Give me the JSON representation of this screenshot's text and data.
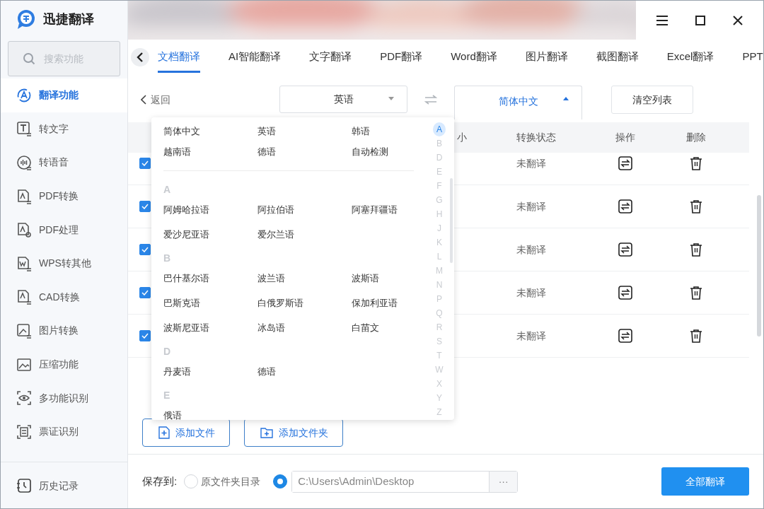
{
  "app": {
    "title": "迅捷翻译"
  },
  "sidebar": {
    "search": {
      "placeholder": "搜索功能"
    },
    "items": [
      {
        "label": "翻译功能",
        "selected": true
      },
      {
        "label": "转文字",
        "selected": false
      },
      {
        "label": "转语音",
        "selected": false
      },
      {
        "label": "PDF转换",
        "selected": false
      },
      {
        "label": "PDF处理",
        "selected": false
      },
      {
        "label": "WPS转其他",
        "selected": false
      },
      {
        "label": "CAD转换",
        "selected": false
      },
      {
        "label": "图片转换",
        "selected": false
      },
      {
        "label": "压缩功能",
        "selected": false
      },
      {
        "label": "多功能识别",
        "selected": false
      },
      {
        "label": "票证识别",
        "selected": false
      }
    ],
    "history": {
      "label": "历史记录"
    }
  },
  "tabs": [
    {
      "label": "文档翻译",
      "selected": true
    },
    {
      "label": "AI智能翻译",
      "selected": false
    },
    {
      "label": "文字翻译",
      "selected": false
    },
    {
      "label": "PDF翻译",
      "selected": false
    },
    {
      "label": "Word翻译",
      "selected": false
    },
    {
      "label": "图片翻译",
      "selected": false
    },
    {
      "label": "截图翻译",
      "selected": false
    },
    {
      "label": "Excel翻译",
      "selected": false
    },
    {
      "label": "PPT",
      "selected": false
    }
  ],
  "toolbar": {
    "back": "返回",
    "source_language": "英语",
    "target_language": "简体中文",
    "target_expanded": true,
    "clear_button": "清空列表"
  },
  "table": {
    "columns": [
      "小",
      "转换状态",
      "操作",
      "删除"
    ],
    "rows": [
      {
        "checked": true,
        "status": "未翻译"
      },
      {
        "checked": true,
        "status": "未翻译"
      },
      {
        "checked": true,
        "status": "未翻译"
      },
      {
        "checked": true,
        "status": "未翻译"
      },
      {
        "checked": true,
        "status": "未翻译"
      }
    ]
  },
  "language_menu": {
    "common": [
      "简体中文",
      "英语",
      "韩语",
      "越南语",
      "德语",
      "自动检测"
    ],
    "sections": [
      {
        "letter": "A",
        "languages": [
          "阿姆哈拉语",
          "阿拉伯语",
          "阿塞拜疆语",
          "爱沙尼亚语",
          "爱尔兰语"
        ]
      },
      {
        "letter": "B",
        "languages": [
          "巴什基尔语",
          "波兰语",
          "波斯语",
          "巴斯克语",
          "白俄罗斯语",
          "保加利亚语",
          "波斯尼亚语",
          "冰岛语",
          "白苗文"
        ]
      },
      {
        "letter": "D",
        "languages": [
          "丹麦语",
          "德语"
        ]
      },
      {
        "letter": "E",
        "languages": [
          "俄语"
        ]
      }
    ],
    "index": [
      {
        "letter": "A",
        "selected": true
      },
      {
        "letter": "B",
        "selected": false
      },
      {
        "letter": "D",
        "selected": false
      },
      {
        "letter": "E",
        "selected": false
      },
      {
        "letter": "F",
        "selected": false
      },
      {
        "letter": "G",
        "selected": false
      },
      {
        "letter": "H",
        "selected": false
      },
      {
        "letter": "J",
        "selected": false
      },
      {
        "letter": "K",
        "selected": false
      },
      {
        "letter": "L",
        "selected": false
      },
      {
        "letter": "M",
        "selected": false
      },
      {
        "letter": "N",
        "selected": false
      },
      {
        "letter": "P",
        "selected": false
      },
      {
        "letter": "Q",
        "selected": false
      },
      {
        "letter": "R",
        "selected": false
      },
      {
        "letter": "S",
        "selected": false
      },
      {
        "letter": "T",
        "selected": false
      },
      {
        "letter": "W",
        "selected": false
      },
      {
        "letter": "X",
        "selected": false
      },
      {
        "letter": "Y",
        "selected": false
      },
      {
        "letter": "Z",
        "selected": false
      }
    ]
  },
  "add_buttons": [
    {
      "label": "添加文件",
      "kind": "file"
    },
    {
      "label": "添加文件夹",
      "kind": "folder"
    }
  ],
  "footer": {
    "save_label": "保存到:",
    "options": [
      {
        "kind": "label",
        "label": "原文件夹目录",
        "selected": false
      },
      {
        "kind": "path",
        "value": "C:\\Users\\Admin\\Desktop",
        "selected": true
      }
    ],
    "browse": "···",
    "translate_button": "全部翻译"
  }
}
